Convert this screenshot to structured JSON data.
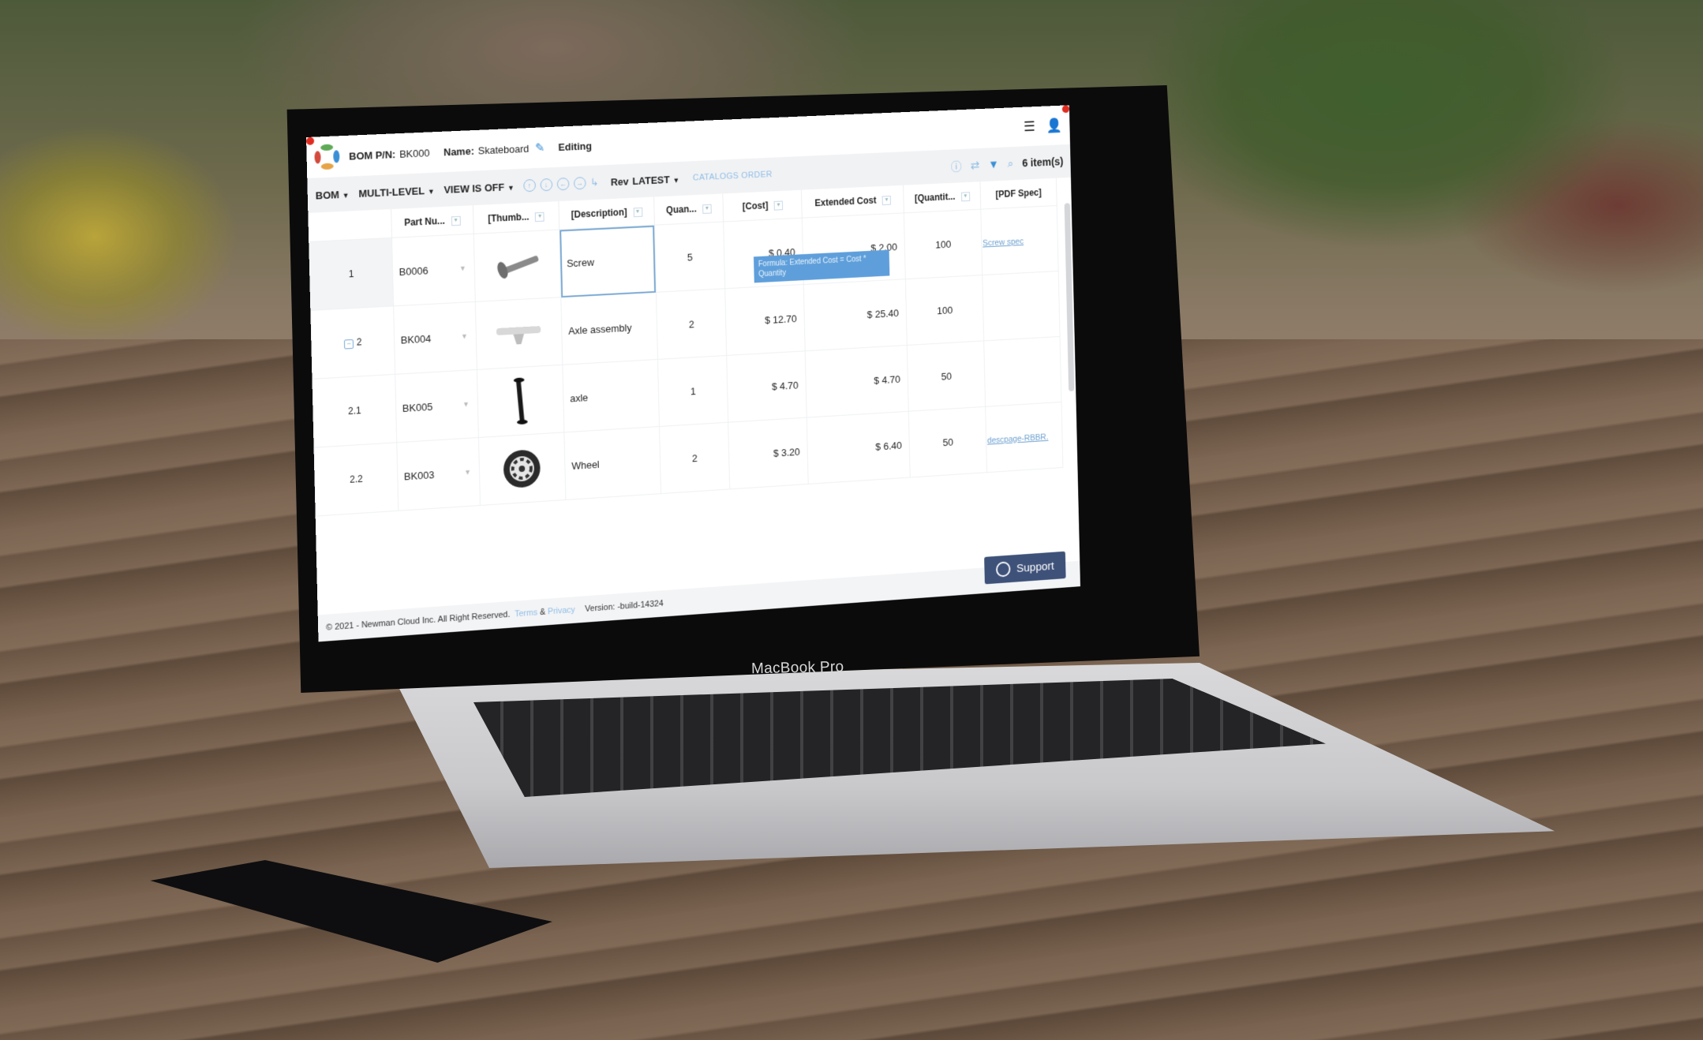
{
  "device": {
    "label": "MacBook Pro"
  },
  "header": {
    "bom_pn_label": "BOM P/N:",
    "bom_pn_value": "BK000",
    "name_label": "Name:",
    "name_value": "Skateboard",
    "mode": "Editing"
  },
  "toolbar": {
    "bom_label": "BOM",
    "multilevel_label": "MULTI-LEVEL",
    "view_label": "VIEW IS OFF",
    "rev_label": "Rev",
    "rev_value": "LATEST",
    "catalogs_order_label": "CATALOGS ORDER",
    "item_count": "6 item(s)"
  },
  "table": {
    "columns": [
      "",
      "Part Nu...",
      "[Thumb...",
      "[Description]",
      "Quan...",
      "[Cost]",
      "Extended Cost",
      "[Quantit...",
      "[PDF Spec]"
    ],
    "rows": [
      {
        "index": "1",
        "part_number": "B0006",
        "thumbnail": "screw",
        "description": "Screw",
        "quantity": "5",
        "cost": "$ 0.40",
        "extended_cost": "$ 2.00",
        "stock_quantity": "100",
        "pdf_spec": "Screw spec"
      },
      {
        "index": "2",
        "part_number": "BK004",
        "thumbnail": "axle-assembly",
        "description": "Axle assembly",
        "quantity": "2",
        "cost": "$ 12.70",
        "extended_cost": "$ 25.40",
        "stock_quantity": "100",
        "pdf_spec": ""
      },
      {
        "index": "2.1",
        "part_number": "BK005",
        "thumbnail": "axle",
        "description": "axle",
        "quantity": "1",
        "cost": "$ 4.70",
        "extended_cost": "$ 4.70",
        "stock_quantity": "50",
        "pdf_spec": ""
      },
      {
        "index": "2.2",
        "part_number": "BK003",
        "thumbnail": "wheel",
        "description": "Wheel",
        "quantity": "2",
        "cost": "$ 3.20",
        "extended_cost": "$ 6.40",
        "stock_quantity": "50",
        "pdf_spec": "descpage-RBBR."
      }
    ]
  },
  "tooltip": {
    "formula": "Formula: Extended Cost = Cost * Quantity"
  },
  "footer": {
    "copyright": "© 2021 - Newman Cloud Inc. All Right Reserved.",
    "terms": "Terms",
    "amp": "&",
    "privacy": "Privacy",
    "version": "Version: -build-14324"
  },
  "support": {
    "label": "Support"
  },
  "colors": {
    "accent": "#3a8fd6",
    "support_bg": "#3e5179",
    "tooltip_bg": "#5e9fdb"
  }
}
